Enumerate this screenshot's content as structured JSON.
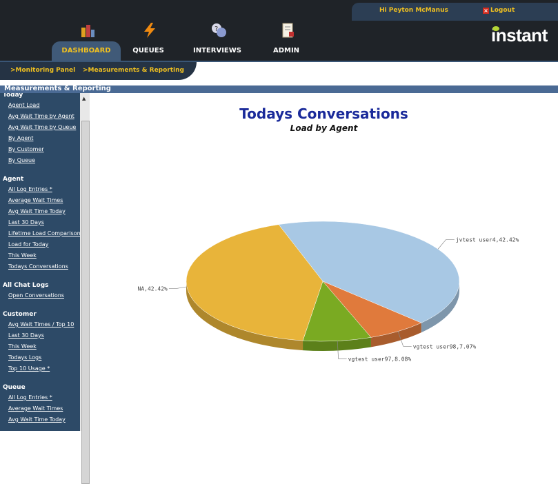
{
  "header": {
    "greeting": "Hi Peyton McManus",
    "logout": "Logout",
    "brand": "instant"
  },
  "tabs": [
    {
      "label": "DASHBOARD",
      "icon": "dashboard-icon"
    },
    {
      "label": "QUEUES",
      "icon": "lightning-icon"
    },
    {
      "label": "INTERVIEWS",
      "icon": "question-bubbles-icon"
    },
    {
      "label": "ADMIN",
      "icon": "document-tools-icon"
    }
  ],
  "subnav": [
    {
      "label": ">Monitoring Panel"
    },
    {
      "label": ">Measurements & Reporting"
    }
  ],
  "section_title": "Measurements & Reporting",
  "sidebar": {
    "groups": [
      {
        "title": "Today",
        "items": [
          "Agent Load",
          "Avg Wait Time by Agent",
          "Avg Wait Time by Queue",
          "By Agent",
          "By Customer",
          "By Queue"
        ]
      },
      {
        "title": "Agent",
        "items": [
          "All Log Entries *",
          "Average Wait Times",
          "Avg Wait Time Today",
          "Last 30 Days",
          "Lifetime Load Comparison",
          "Load for Today",
          "This Week",
          "Todays Conversations"
        ]
      },
      {
        "title": "All Chat Logs",
        "items": [
          "Open Conversations"
        ]
      },
      {
        "title": "Customer",
        "items": [
          "Avg Wait Times / Top 10",
          "Last 30 Days",
          "This Week",
          "Todays Logs",
          "Top 10 Usage *"
        ]
      },
      {
        "title": "Queue",
        "items": [
          "All Log Entries *",
          "Average Wait Times",
          "Avg Wait Time Today"
        ]
      }
    ]
  },
  "chart_data": {
    "type": "pie",
    "title": "Todays Conversations",
    "subtitle": "Load by Agent",
    "slices": [
      {
        "name": "jvtest user4",
        "value": 42.42,
        "label": "jvtest user4,42.42%",
        "color": "#a8c8e4"
      },
      {
        "name": "vgtest user98",
        "value": 7.07,
        "label": "vgtest user98,7.07%",
        "color": "#e07a3c"
      },
      {
        "name": "vgtest user97",
        "value": 8.08,
        "label": "vgtest user97,8.08%",
        "color": "#7aaa22"
      },
      {
        "name": "NA",
        "value": 42.42,
        "label": "NA,42.42%",
        "color": "#e8b43a"
      }
    ]
  },
  "colors": {
    "accent": "#f0c020",
    "nav": "#2d4a67",
    "title": "#1a2a9a"
  }
}
